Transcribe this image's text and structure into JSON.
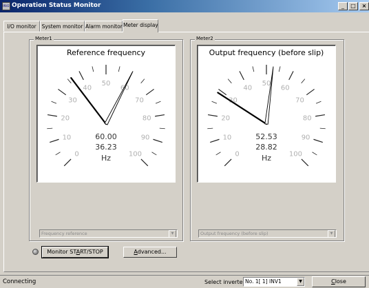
{
  "window": {
    "title": "Operation Status Monitor",
    "icon_text": "INV2",
    "minimize_glyph": "_",
    "maximize_glyph": "□",
    "close_glyph": "×"
  },
  "tabs": [
    {
      "label": "I/O monitor",
      "active": false
    },
    {
      "label": "System monitor",
      "active": false
    },
    {
      "label": "Alarm monitor",
      "active": false
    },
    {
      "label": "Meter display",
      "active": true
    }
  ],
  "meter1": {
    "group_label": "Meter1",
    "title": "Reference frequency",
    "value_primary": "60.00",
    "value_secondary": "36.23",
    "unit": "Hz",
    "scale_labels": [
      "0",
      "10",
      "20",
      "30",
      "40",
      "50",
      "60",
      "70",
      "80",
      "90",
      "100"
    ],
    "needle_black_value": 36.23,
    "needle_outline_value": 60.0,
    "select_value": "Frequency reference"
  },
  "meter2": {
    "group_label": "Meter2",
    "title": "Output frequency (before slip)",
    "value_primary": "52.53",
    "value_secondary": "28.82",
    "unit": "Hz",
    "scale_labels": [
      "0",
      "10",
      "20",
      "30",
      "40",
      "50",
      "60",
      "70",
      "80",
      "90",
      "100"
    ],
    "needle_black_value": 28.82,
    "needle_outline_value": 52.53,
    "select_value": "Output frequency (before slip)"
  },
  "controls": {
    "monitor_button": {
      "pre": "Monitor ST",
      "hotkey": "A",
      "post": "RT/STOP"
    },
    "advanced_button": {
      "hotkey": "A",
      "rest": "dvanced..."
    }
  },
  "status": {
    "text": "Connecting",
    "inverter_label": "Select inverter",
    "inverter_value": "No. 1[ 1] INV1",
    "close_button": {
      "hotkey": "C",
      "rest": "lose"
    }
  },
  "colors": {
    "face": "#d4d0c8",
    "title_start": "#0a246a",
    "title_end": "#a6caf0",
    "needle": "#000000"
  }
}
